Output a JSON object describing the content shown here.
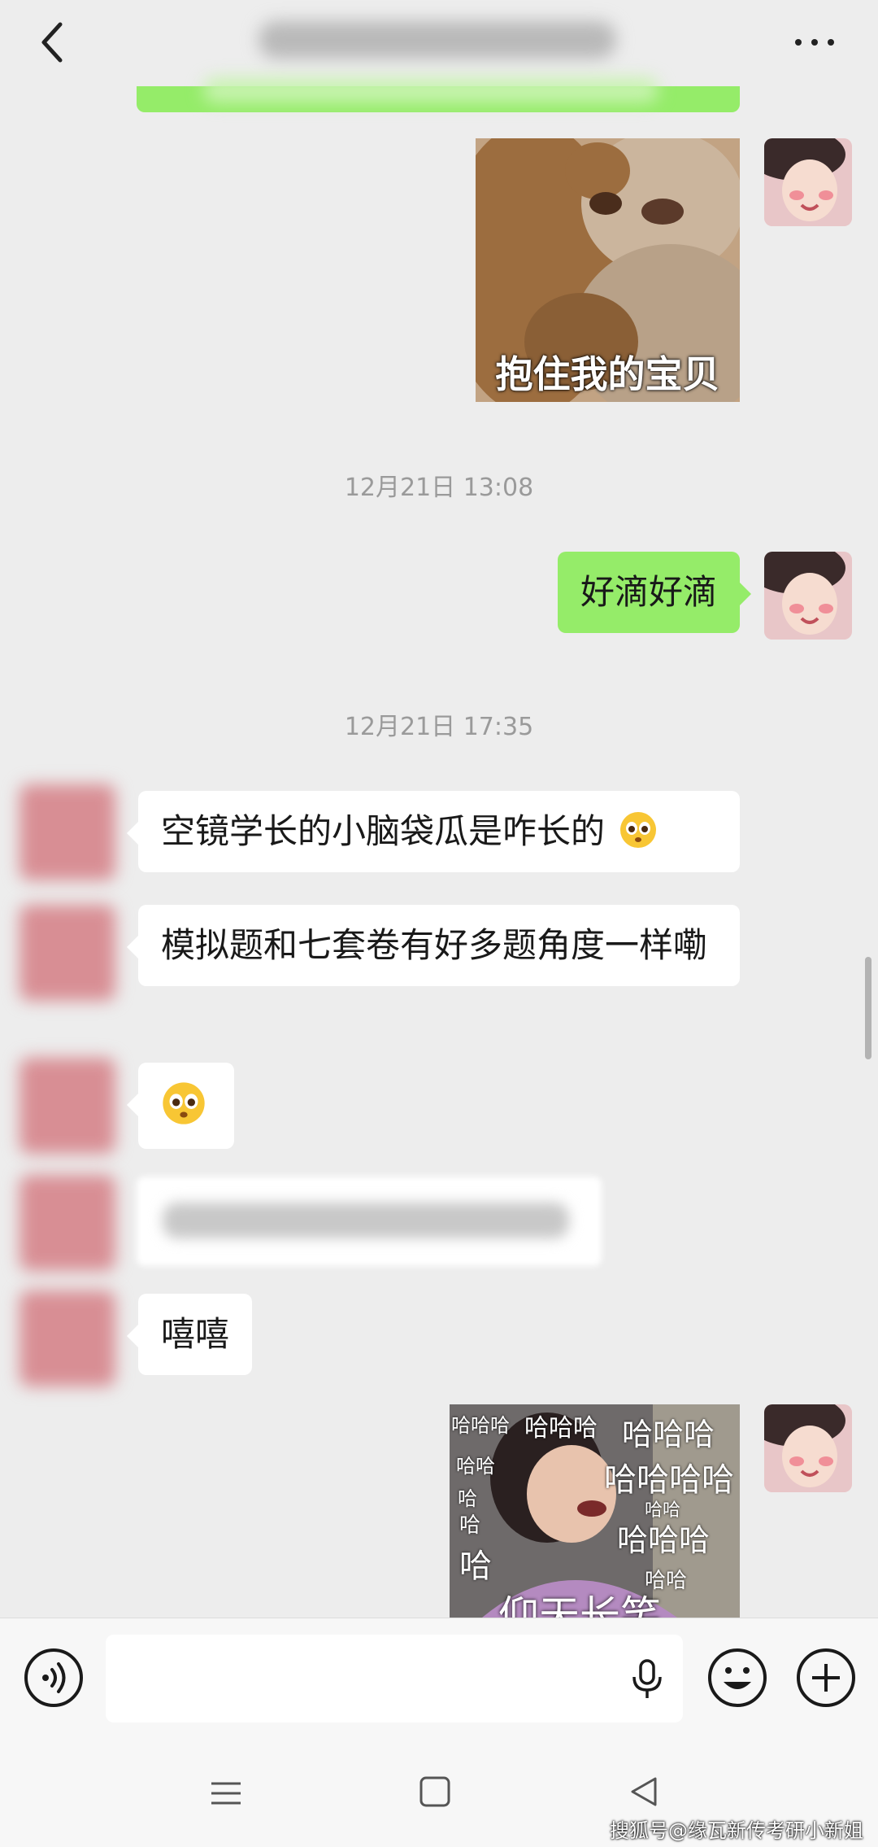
{
  "header": {
    "title": ""
  },
  "messages": {
    "sticker1_caption": "抱住我的宝贝",
    "time1": "12月21日 13:08",
    "mine_text": "好滴好滴",
    "time2": "12月21日 17:35",
    "their_msg1": "空镜学长的小脑袋瓜是咋长的",
    "their_msg2": "模拟题和七套卷有好多题角度一样嘞",
    "their_msg4": "嘻嘻",
    "sticker2_words": [
      "哈哈哈",
      "哈哈哈",
      "哈哈哈",
      "哈哈哈哈",
      "哈哈",
      "哈哈哈",
      "哈",
      "哈哈",
      "哈",
      "哈",
      "哈哈",
      "仰天长笑"
    ]
  },
  "watermark": "搜狐号@缘瓦新传考研小新姐",
  "colors": {
    "my_bubble": "#95ec69",
    "their_bubble": "#ffffff",
    "background": "#ededed"
  },
  "icons": [
    "back-icon",
    "more-icon",
    "voice-icon",
    "microphone-icon",
    "emoji-icon",
    "plus-icon",
    "menu-icon",
    "home-icon",
    "nav-back-icon"
  ]
}
